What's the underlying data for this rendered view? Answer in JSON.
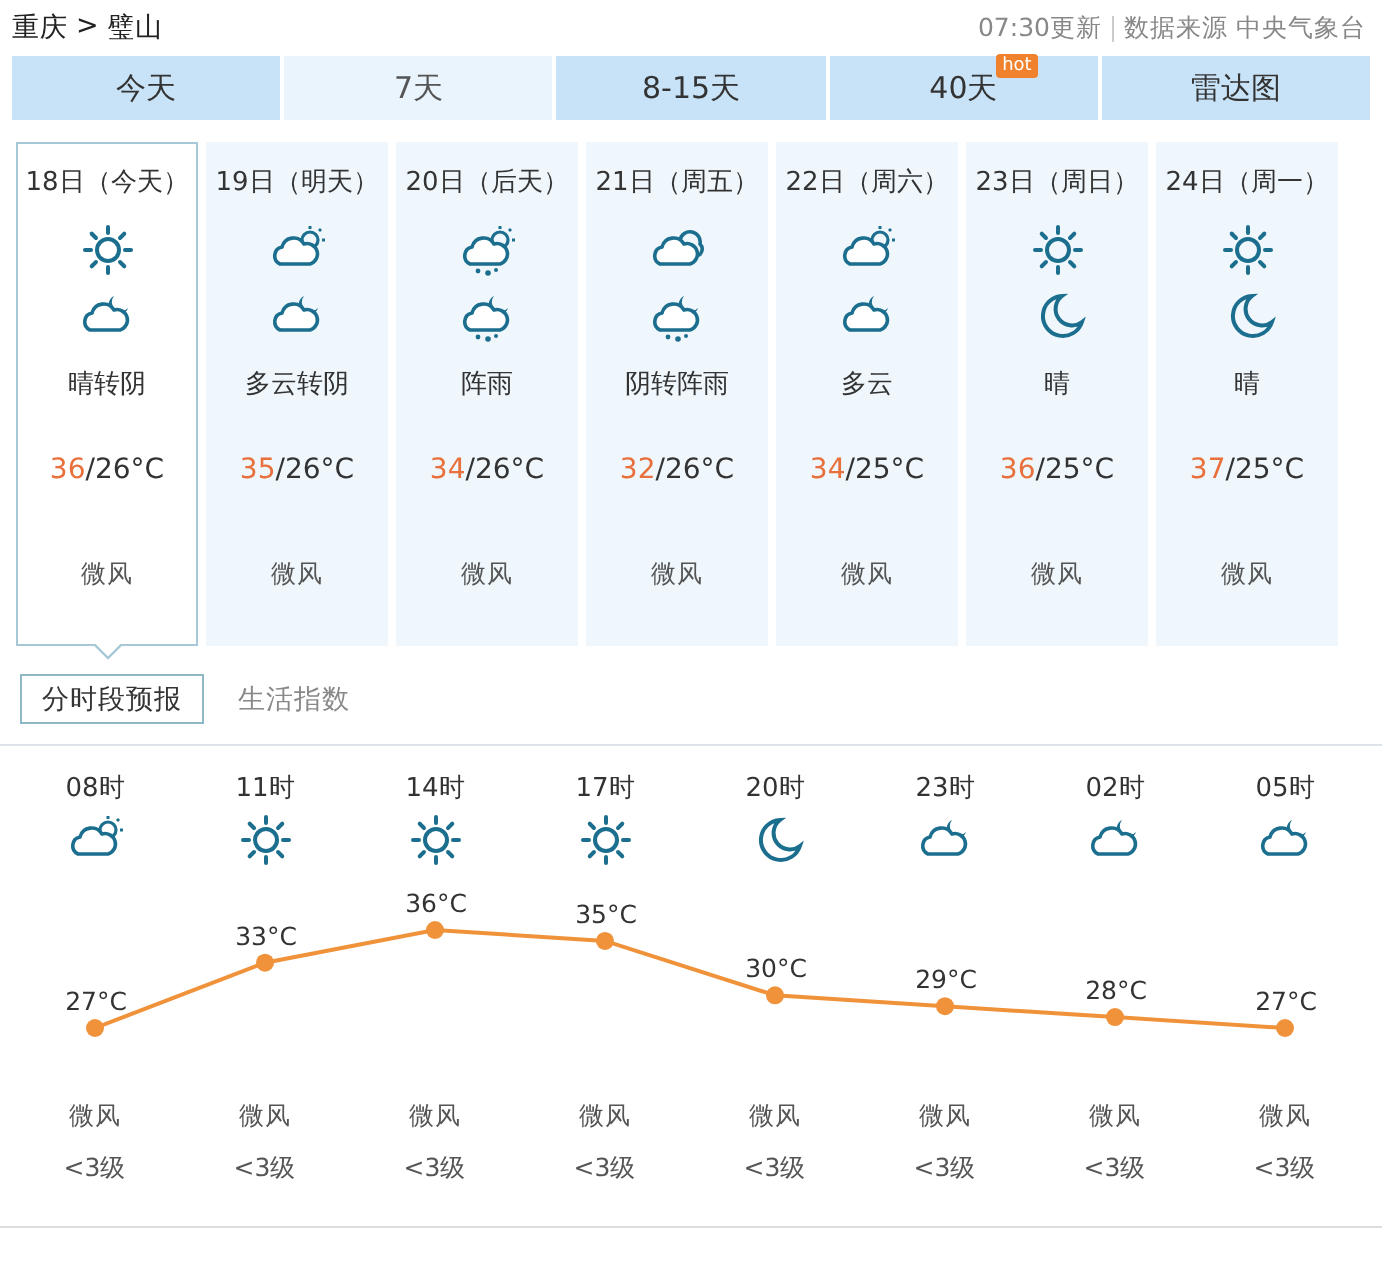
{
  "breadcrumb": {
    "region": "重庆",
    "separator": ">",
    "city": "璧山"
  },
  "update": {
    "time": "07:30更新",
    "source": "数据来源 中央气象台"
  },
  "tabs": [
    {
      "label": "今天",
      "selected": false
    },
    {
      "label": "7天",
      "selected": true
    },
    {
      "label": "8-15天",
      "selected": false
    },
    {
      "label": "40天",
      "selected": false,
      "badge": "hot"
    },
    {
      "label": "雷达图",
      "selected": false
    }
  ],
  "days": [
    {
      "date": "18日（今天）",
      "icons": [
        {
          "kind": "sunny"
        },
        {
          "kind": "cloudy_night"
        }
      ],
      "weather": "晴转阴",
      "high": "36",
      "low": "/26°C",
      "wind": "微风",
      "selected": true
    },
    {
      "date": "19日（明天）",
      "icons": [
        {
          "kind": "partly_cloudy"
        },
        {
          "kind": "cloudy_night"
        }
      ],
      "weather": "多云转阴",
      "high": "35",
      "low": "/26°C",
      "wind": "微风",
      "selected": false
    },
    {
      "date": "20日（后天）",
      "icons": [
        {
          "kind": "shower"
        },
        {
          "kind": "shower_night"
        }
      ],
      "weather": "阵雨",
      "high": "34",
      "low": "/26°C",
      "wind": "微风",
      "selected": false
    },
    {
      "date": "21日（周五）",
      "icons": [
        {
          "kind": "cloudy"
        },
        {
          "kind": "shower_night"
        }
      ],
      "weather": "阴转阵雨",
      "high": "32",
      "low": "/26°C",
      "wind": "微风",
      "selected": false
    },
    {
      "date": "22日（周六）",
      "icons": [
        {
          "kind": "partly_cloudy"
        },
        {
          "kind": "cloudy_night"
        }
      ],
      "weather": "多云",
      "high": "34",
      "low": "/25°C",
      "wind": "微风",
      "selected": false
    },
    {
      "date": "23日（周日）",
      "icons": [
        {
          "kind": "sunny"
        },
        {
          "kind": "clear_night"
        }
      ],
      "weather": "晴",
      "high": "36",
      "low": "/25°C",
      "wind": "微风",
      "selected": false
    },
    {
      "date": "24日（周一）",
      "icons": [
        {
          "kind": "sunny"
        },
        {
          "kind": "clear_night"
        }
      ],
      "weather": "晴",
      "high": "37",
      "low": "/25°C",
      "wind": "微风",
      "selected": false
    }
  ],
  "subtabs": [
    {
      "label": "分时段预报",
      "selected": true
    },
    {
      "label": "生活指数",
      "selected": false
    }
  ],
  "hourly": [
    {
      "kind": "partly_cloudy",
      "unit": "°C",
      "wind": "微风",
      "level": "<3级"
    },
    {
      "kind": "sunny",
      "unit": "°C",
      "wind": "微风",
      "level": "<3级"
    },
    {
      "kind": "sunny",
      "unit": "°C",
      "wind": "微风",
      "level": "<3级"
    },
    {
      "kind": "sunny",
      "unit": "°C",
      "wind": "微风",
      "level": "<3级"
    },
    {
      "kind": "clear_night",
      "unit": "°C",
      "wind": "微风",
      "level": "<3级"
    },
    {
      "kind": "cloudy_night",
      "unit": "°C",
      "wind": "微风",
      "level": "<3级"
    },
    {
      "kind": "cloudy_night",
      "unit": "°C",
      "wind": "微风",
      "level": "<3级"
    },
    {
      "kind": "cloudy_night",
      "unit": "°C",
      "wind": "微风",
      "level": "<3级"
    }
  ],
  "chart_data": {
    "type": "line",
    "categories": [
      "08时",
      "11时",
      "14时",
      "17时",
      "20时",
      "23时",
      "02时",
      "05时"
    ],
    "series": [
      {
        "color": "#f0923a",
        "marker": true,
        "values": [
          27,
          33,
          36,
          35,
          30,
          29,
          28,
          27
        ]
      }
    ],
    "data_labels": true
  }
}
